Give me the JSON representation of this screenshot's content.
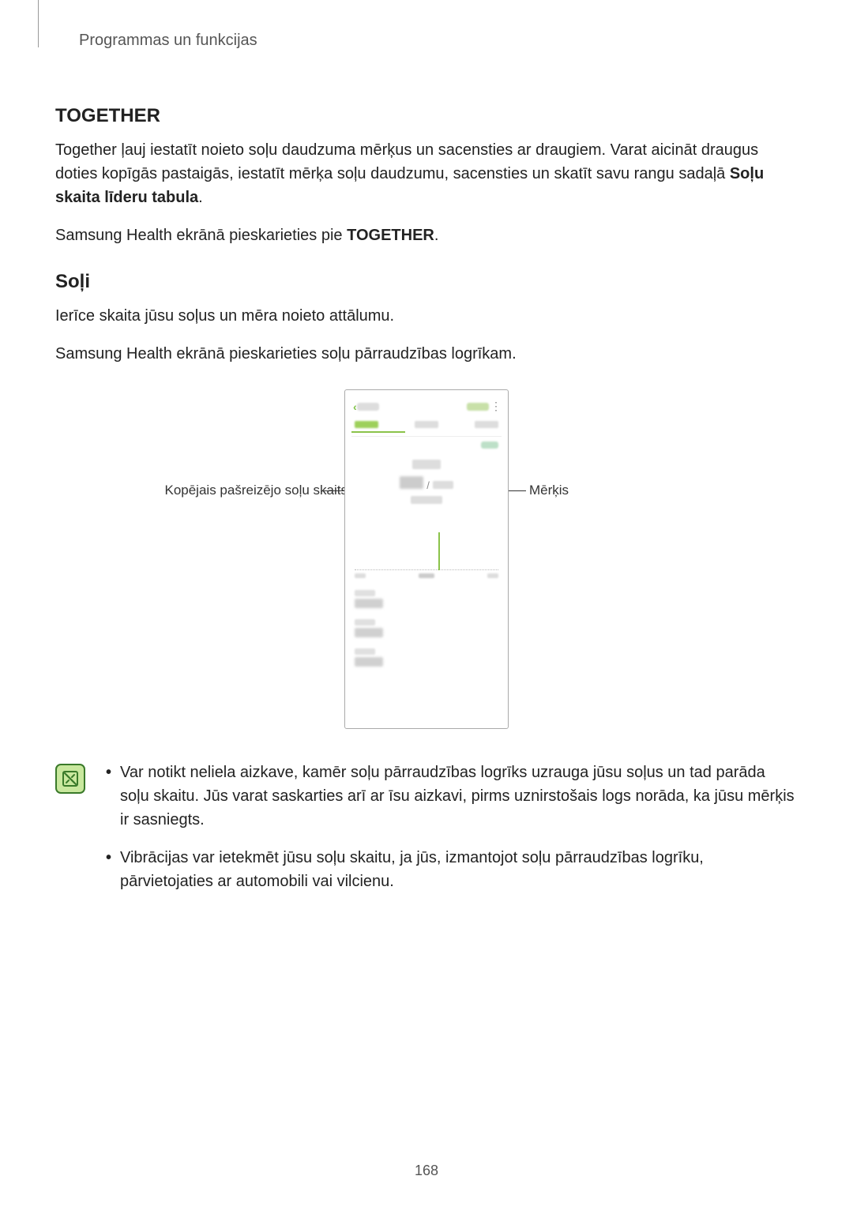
{
  "header": "Programmas un funkcijas",
  "together": {
    "title": "TOGETHER",
    "p1_a": "Together ļauj iestatīt noieto soļu daudzuma mērķus un sacensties ar draugiem. Varat aicināt draugus doties kopīgās pastaigās, iestatīt mērķa soļu daudzumu, sacensties un skatīt savu rangu sadaļā ",
    "p1_bold": "Soļu skaita līderu tabula",
    "p1_b": ".",
    "p2_a": "Samsung Health ekrānā pieskarieties pie ",
    "p2_bold": "TOGETHER",
    "p2_b": "."
  },
  "steps": {
    "title": "Soļi",
    "p1": "Ierīce skaita jūsu soļus un mēra noieto attālumu.",
    "p2": "Samsung Health ekrānā pieskarieties soļu pārraudzības logrīkam."
  },
  "callouts": {
    "left": "Kopējais pašreizējo soļu skaits",
    "right": "Mērķis"
  },
  "phone": {
    "slash": "/"
  },
  "notes": {
    "item1": "Var notikt neliela aizkave, kamēr soļu pārraudzības logrīks uzrauga jūsu soļus un tad parāda soļu skaitu. Jūs varat saskarties arī ar īsu aizkavi, pirms uznirstošais logs norāda, ka jūsu mērķis ir sasniegts.",
    "item2": "Vibrācijas var ietekmēt jūsu soļu skaitu, ja jūs, izmantojot soļu pārraudzības logrīku, pārvietojaties ar automobili vai vilcienu."
  },
  "pageNumber": "168"
}
